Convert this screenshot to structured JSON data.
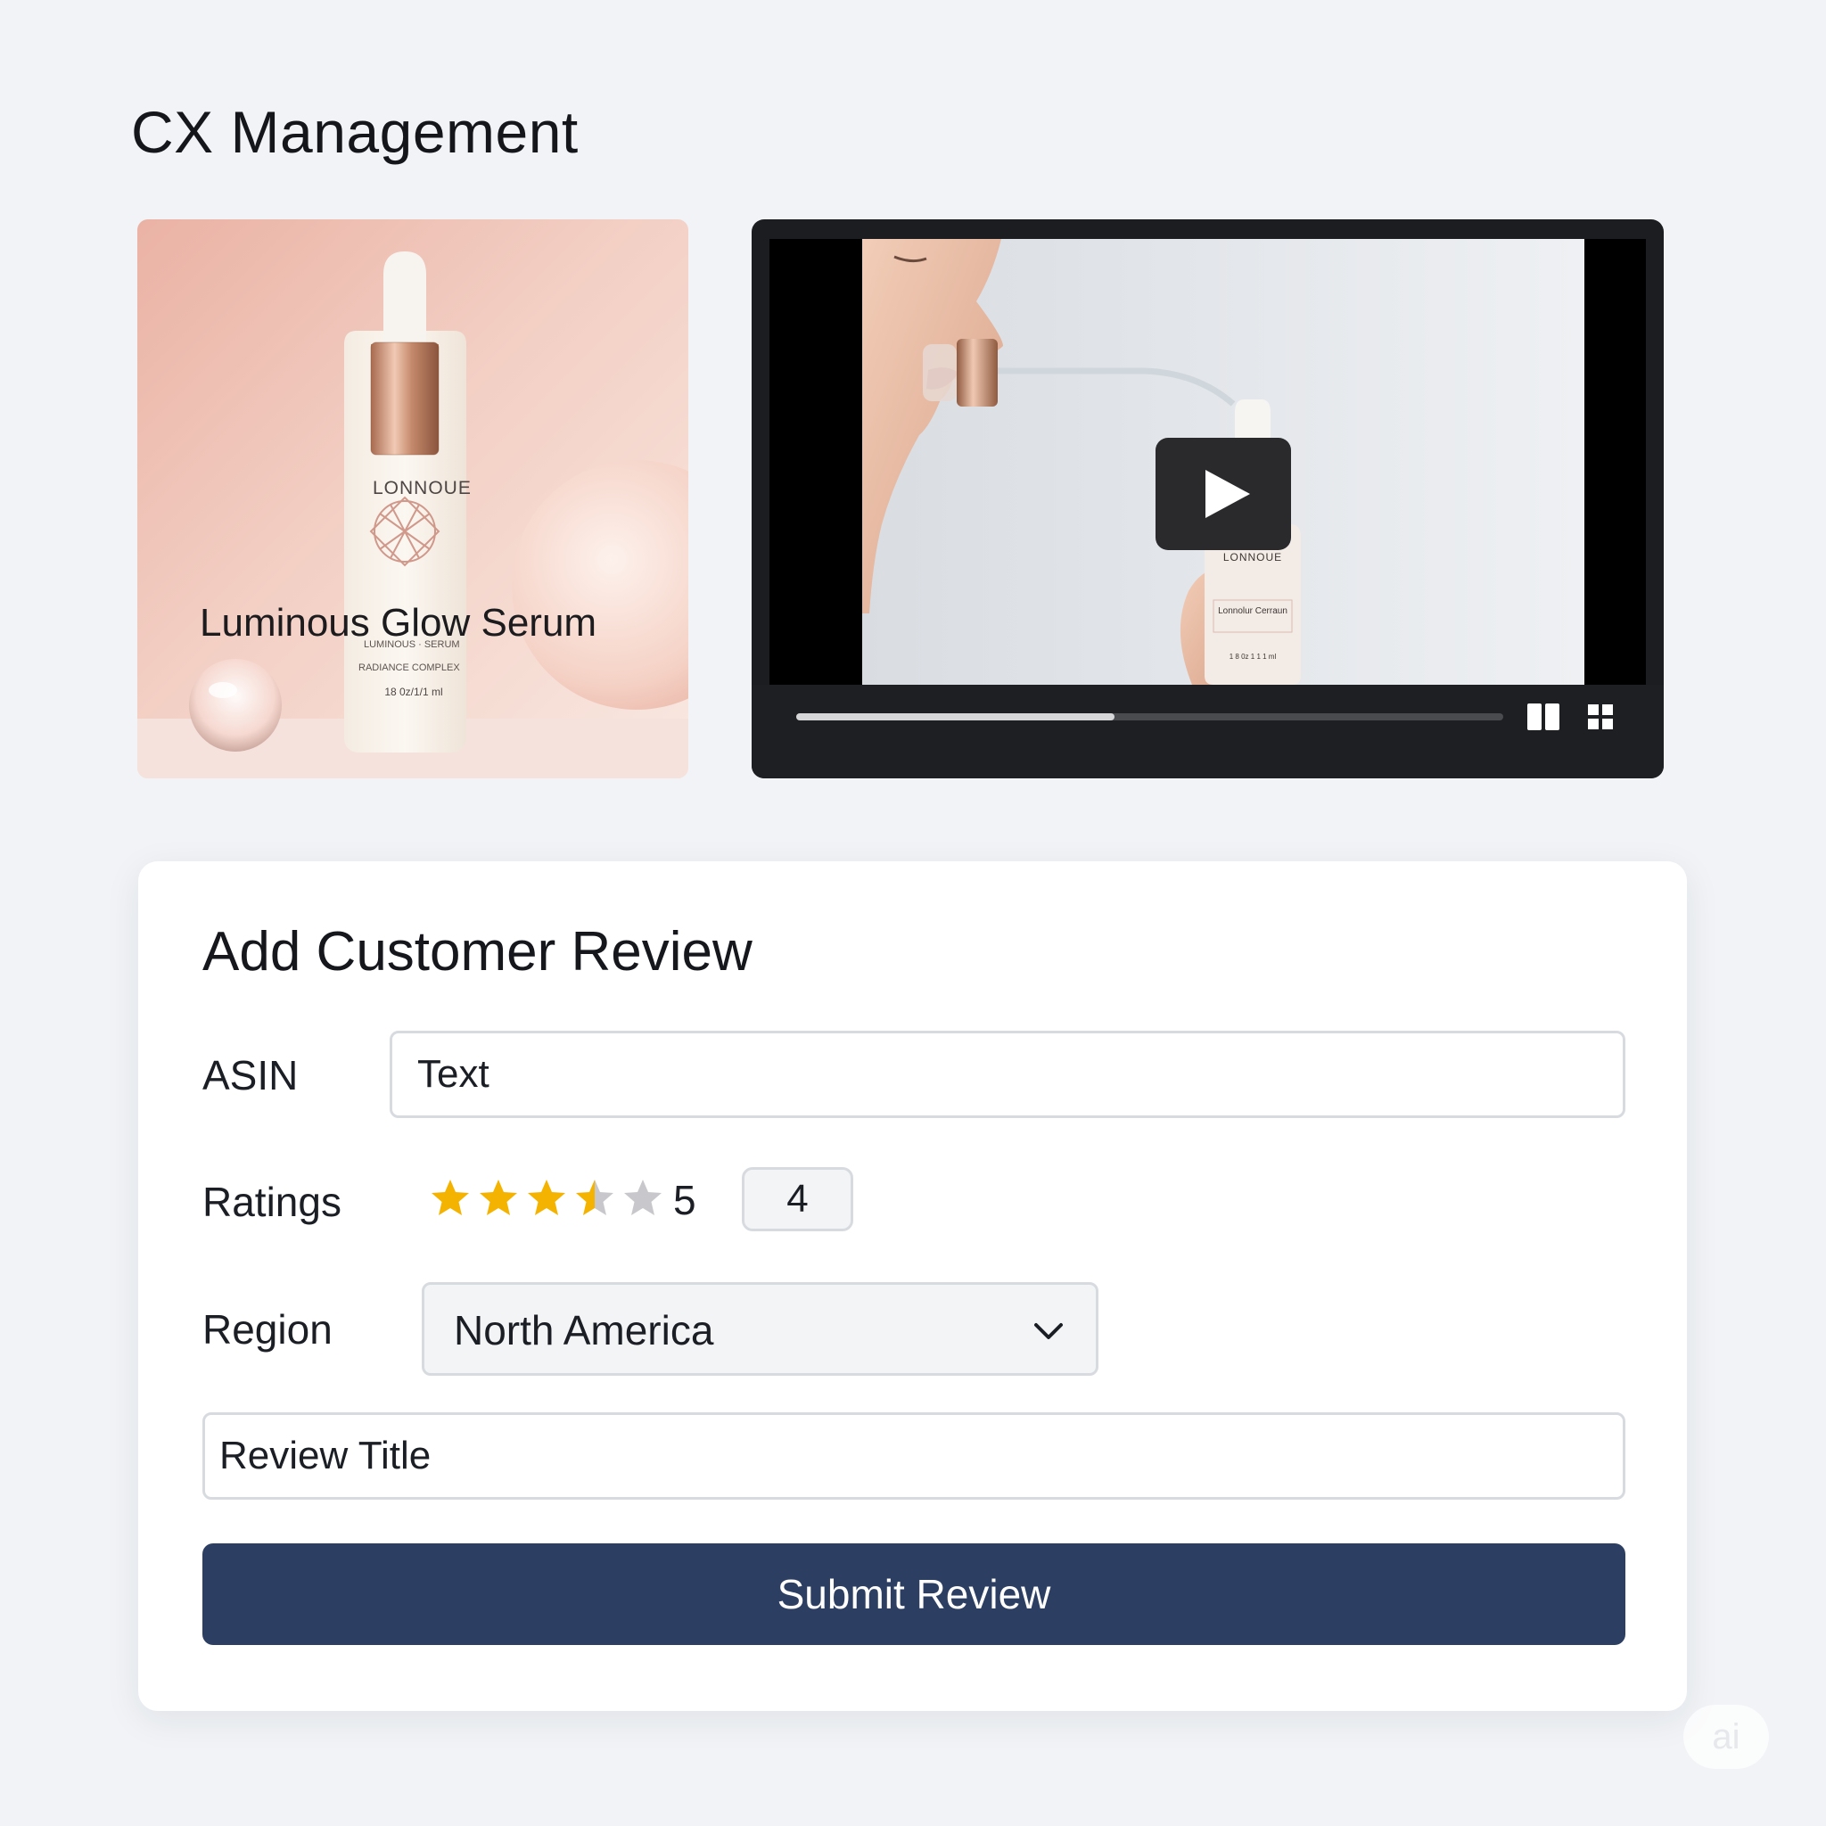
{
  "page": {
    "title": "CX Management"
  },
  "product": {
    "name": "Luminous Glow Serum",
    "bottle_brand": "LONNOUE",
    "bottle_volume": "18 0z/1/1 ml"
  },
  "video": {
    "bottle_brand": "LONNOUE",
    "bottle_label": "Lonnolur Cerraun",
    "bottle_volume": "1 8 0z 1 1 1 ml",
    "progress_fraction": 0.45,
    "controls": [
      "play-icon",
      "split-view-icon",
      "grid-icon"
    ]
  },
  "review_form": {
    "title": "Add Customer Review",
    "asin": {
      "label": "ASIN",
      "value": "Text"
    },
    "ratings": {
      "label": "Ratings",
      "max": "5",
      "value": "4",
      "filled_stars": 3.5
    },
    "region": {
      "label": "Region",
      "selected": "North America"
    },
    "review_title": {
      "value": "Review Title"
    },
    "submit_label": "Submit Review"
  },
  "colors": {
    "background": "#f1f3f6",
    "accent": "#2c3e62",
    "star": "#f5b301",
    "star_empty": "#c8c8cc"
  },
  "watermark": {
    "text": "ai"
  }
}
